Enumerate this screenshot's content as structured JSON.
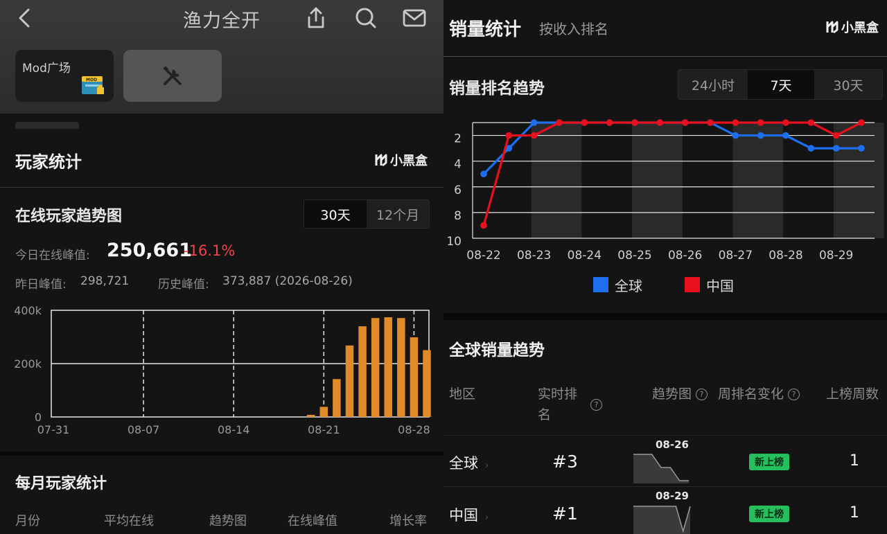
{
  "left": {
    "header": {
      "title": "渔力全开",
      "back_icon": "chevron-left-icon",
      "share_icon": "share-icon",
      "search_icon": "search-icon",
      "mail_icon": "mail-icon"
    },
    "tiles": {
      "mod_label": "Mod广场",
      "tools_icon": "tools-icon"
    },
    "player_stats": {
      "title": "玩家统计",
      "brand": "小黑盒",
      "trend_title": "在线玩家趋势图",
      "range_tabs": [
        {
          "label": "30天",
          "active": true
        },
        {
          "label": "12个月",
          "active": false
        }
      ],
      "today_peak_label": "今日在线峰值:",
      "today_peak_value": "250,661",
      "today_peak_delta": "-16.1%",
      "yesterday_peak_label": "昨日峰值:",
      "yesterday_peak_value": "298,721",
      "history_peak_label": "历史峰值:",
      "history_peak_value": "373,887 (2026-08-26)"
    },
    "monthly_stats": {
      "title": "每月玩家统计",
      "columns": [
        "月份",
        "平均在线",
        "趋势图",
        "在线峰值",
        "增长率"
      ]
    }
  },
  "right": {
    "title": "销量统计",
    "subtitle": "按收入排名",
    "brand": "小黑盒",
    "rank_trend_title": "销量排名趋势",
    "range_tabs": [
      {
        "label": "24小时",
        "active": false
      },
      {
        "label": "7天",
        "active": true
      },
      {
        "label": "30天",
        "active": false
      }
    ],
    "global_title": "全球销量趋势",
    "table": {
      "headers": {
        "region": "地区",
        "rank": "实时排名",
        "trend": "趋势图",
        "weekly_change": "周排名变化",
        "weeks": "上榜周数"
      },
      "rows": [
        {
          "region": "全球",
          "rank": "#3",
          "trend_date": "08-26",
          "change": "新上榜",
          "weeks": "1"
        },
        {
          "region": "中国",
          "rank": "#1",
          "trend_date": "08-29",
          "change": "新上榜",
          "weeks": "1"
        }
      ]
    }
  },
  "colors": {
    "bar": "#e08a2a",
    "global_line": "#1e6ff0",
    "china_line": "#e8101c",
    "up_badge": "#25c05d",
    "down": "#f0454b"
  },
  "chart_data": [
    {
      "type": "bar",
      "title": "在线玩家趋势图",
      "x_tick_labels": [
        "07-31",
        "08-07",
        "08-14",
        "08-21",
        "08-28"
      ],
      "y_tick_labels": [
        "0",
        "200k",
        "400k"
      ],
      "ylim": [
        0,
        400000
      ],
      "categories": [
        "07-31",
        "08-01",
        "08-02",
        "08-03",
        "08-04",
        "08-05",
        "08-06",
        "08-07",
        "08-08",
        "08-09",
        "08-10",
        "08-11",
        "08-12",
        "08-13",
        "08-14",
        "08-15",
        "08-16",
        "08-17",
        "08-18",
        "08-19",
        "08-20",
        "08-21",
        "08-22",
        "08-23",
        "08-24",
        "08-25",
        "08-26",
        "08-27",
        "08-28",
        "08-29"
      ],
      "values": [
        0,
        0,
        0,
        0,
        0,
        0,
        0,
        0,
        0,
        0,
        0,
        0,
        0,
        0,
        0,
        0,
        0,
        0,
        0,
        0,
        8000,
        38000,
        142000,
        268000,
        340000,
        371000,
        373887,
        371000,
        298721,
        250661
      ]
    },
    {
      "type": "line",
      "title": "销量排名趋势",
      "x_tick_labels": [
        "08-22",
        "08-23",
        "08-24",
        "08-25",
        "08-26",
        "08-27",
        "08-28",
        "08-29"
      ],
      "y_tick_labels": [
        "2",
        "4",
        "6",
        "8",
        "10"
      ],
      "ylim": [
        10,
        1
      ],
      "y_inverted": true,
      "x": [
        "08-22",
        "08-22 12h",
        "08-23",
        "08-23 12h",
        "08-24",
        "08-24 12h",
        "08-25",
        "08-25 12h",
        "08-26",
        "08-26 12h",
        "08-27",
        "08-27 12h",
        "08-28",
        "08-28 12h",
        "08-29",
        "08-29 12h"
      ],
      "series": [
        {
          "name": "全球",
          "color": "#1e6ff0",
          "values": [
            5,
            3,
            1,
            1,
            1,
            1,
            1,
            1,
            1,
            1,
            2,
            2,
            2,
            3,
            3,
            3
          ]
        },
        {
          "name": "中国",
          "color": "#e8101c",
          "values": [
            9,
            2,
            2,
            1,
            1,
            1,
            1,
            1,
            1,
            1,
            1,
            1,
            1,
            1,
            2,
            1
          ]
        }
      ],
      "legend": "bottom"
    },
    {
      "type": "line",
      "title": "",
      "label": "全球",
      "series": [
        {
          "name": "",
          "values": [
            1,
            1,
            1,
            2,
            2,
            3,
            3
          ]
        }
      ]
    },
    {
      "type": "line",
      "title": "",
      "label": "中国",
      "series": [
        {
          "name": "",
          "values": [
            1,
            1,
            1,
            1,
            1,
            1,
            1,
            2,
            1
          ]
        }
      ]
    }
  ]
}
